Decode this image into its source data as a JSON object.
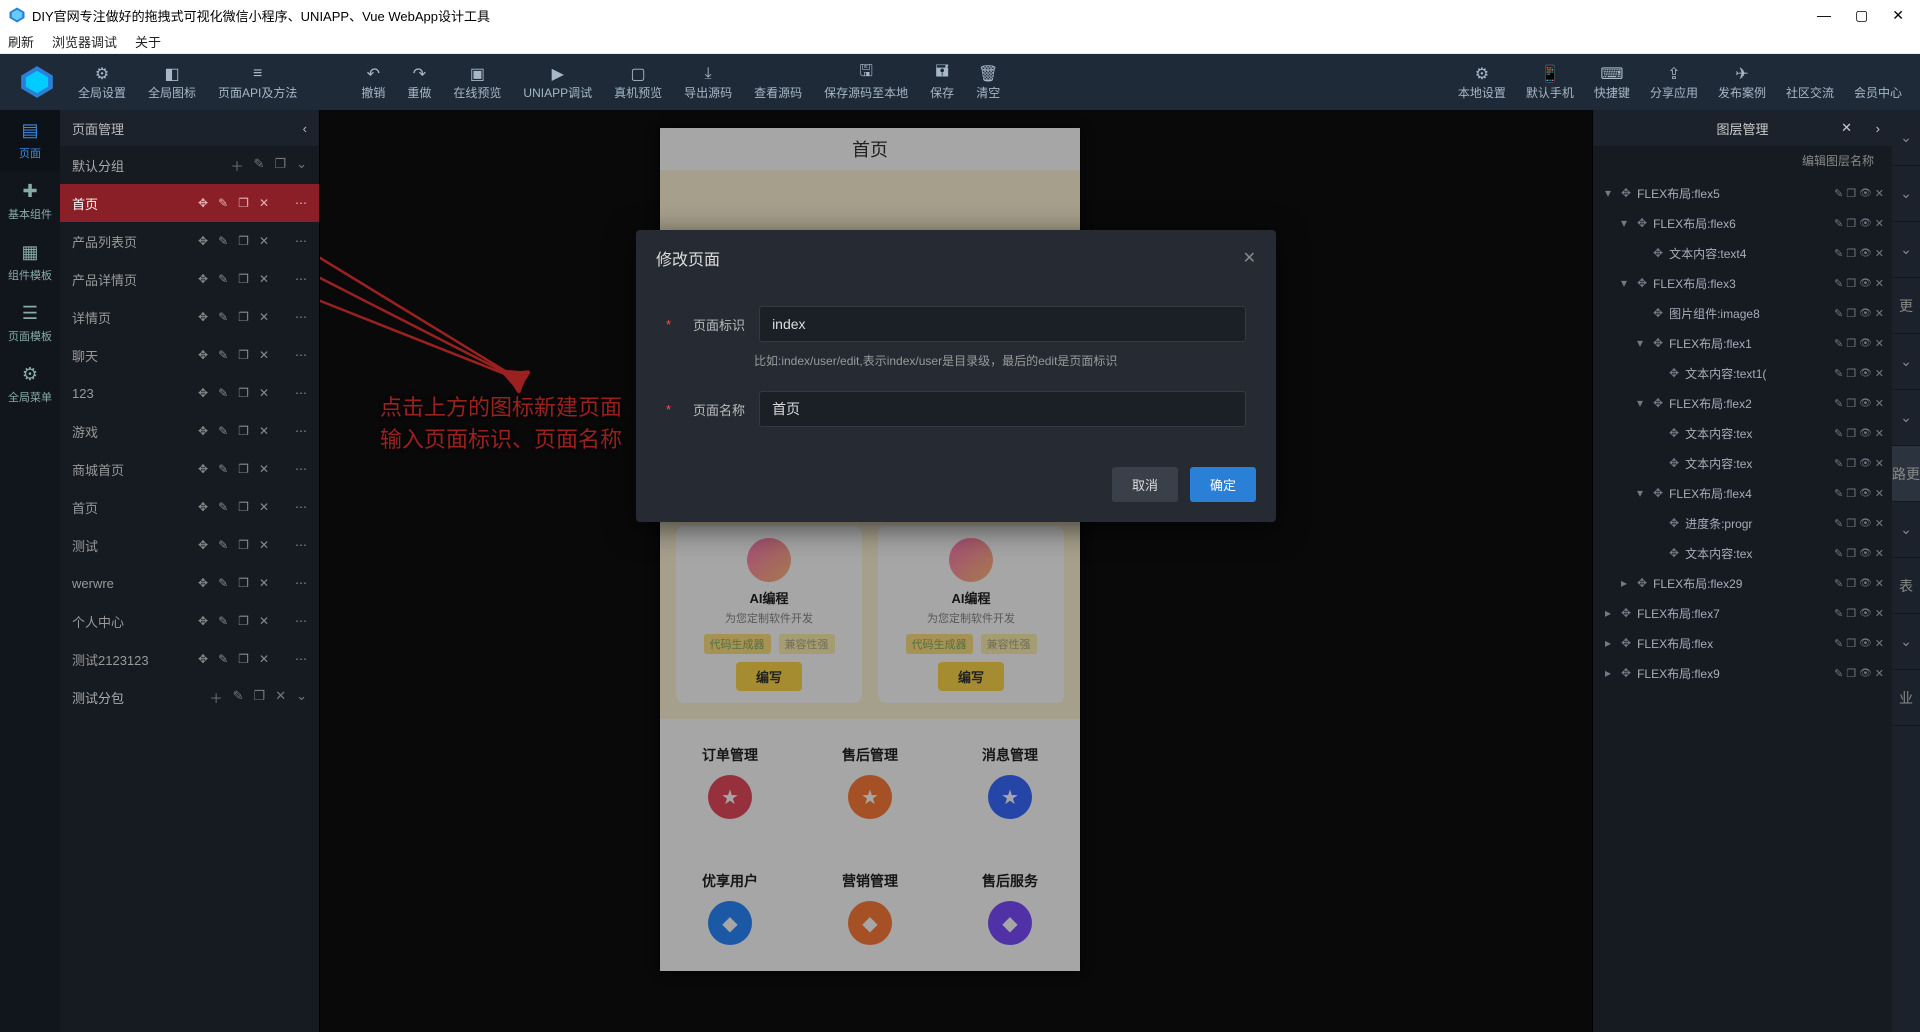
{
  "window": {
    "title": "DIY官网专注做好的拖拽式可视化微信小程序、UNIAPP、Vue WebApp设计工具"
  },
  "menubar": [
    "刷新",
    "浏览器调试",
    "关于"
  ],
  "toolbar": {
    "left": [
      {
        "label": "全局设置",
        "icon": "⚙"
      },
      {
        "label": "全局图标",
        "icon": "◧"
      },
      {
        "label": "页面API及方法",
        "icon": "≡"
      }
    ],
    "mid": [
      {
        "label": "撤销",
        "icon": "↶"
      },
      {
        "label": "重做",
        "icon": "↷"
      },
      {
        "label": "在线预览",
        "icon": "▣"
      },
      {
        "label": "UNIAPP调试",
        "icon": "▶"
      },
      {
        "label": "真机预览",
        "icon": "▢"
      },
      {
        "label": "导出源码",
        "icon": "⤓"
      },
      {
        "label": "查看源码",
        "icon": "</>"
      },
      {
        "label": "保存源码至本地",
        "icon": "🖫"
      },
      {
        "label": "保存",
        "icon": "🖬"
      },
      {
        "label": "清空",
        "icon": "🗑"
      }
    ],
    "right": [
      {
        "label": "本地设置",
        "icon": "⚙"
      },
      {
        "label": "默认手机",
        "icon": "📱"
      },
      {
        "label": "快捷键",
        "icon": "⌨"
      },
      {
        "label": "分享应用",
        "icon": "⇪"
      },
      {
        "label": "发布案例",
        "icon": "✈"
      },
      {
        "label": "社区交流",
        "icon": ""
      },
      {
        "label": "会员中心",
        "icon": ""
      }
    ]
  },
  "leftrail": [
    {
      "label": "页面",
      "icon": "▤",
      "key": "page"
    },
    {
      "label": "基本组件",
      "icon": "✚",
      "key": "basic"
    },
    {
      "label": "组件模板",
      "icon": "▦",
      "key": "tpl"
    },
    {
      "label": "页面模板",
      "icon": "☰",
      "key": "ptpl"
    },
    {
      "label": "全局菜单",
      "icon": "⚙",
      "key": "gmenu"
    }
  ],
  "pagepanel": {
    "title": "页面管理",
    "groups": [
      {
        "name": "默认分组",
        "open": true,
        "pages": [
          {
            "name": "首页",
            "selected": true
          },
          {
            "name": "产品列表页"
          },
          {
            "name": "产品详情页"
          },
          {
            "name": "详情页"
          },
          {
            "name": "聊天"
          },
          {
            "name": "123"
          },
          {
            "name": "游戏"
          },
          {
            "name": "商城首页"
          },
          {
            "name": "首页"
          },
          {
            "name": "测试"
          },
          {
            "name": "werwre"
          },
          {
            "name": "个人中心"
          },
          {
            "name": "测试2123123"
          }
        ]
      },
      {
        "name": "测试分包",
        "open": false
      }
    ]
  },
  "canvas": {
    "device_title": "首页",
    "ai_card": {
      "title": "AI编程",
      "sub": "为您定制软件开发",
      "tag1": "代码生成器",
      "tag2": "兼容性强",
      "btn": "编写"
    },
    "services_a": [
      "订单管理",
      "售后管理",
      "消息管理"
    ],
    "services_b": [
      "优享用户",
      "营销管理",
      "售后服务"
    ]
  },
  "annotation": {
    "line1": "点击上方的图标新建页面",
    "line2": "输入页面标识、页面名称"
  },
  "modal": {
    "title": "修改页面",
    "f1_label": "页面标识",
    "f1_value": "index",
    "hint": "比如:index/user/edit,表示index/user是目录级，最后的edit是页面标识",
    "f2_label": "页面名称",
    "f2_value": "首页",
    "cancel": "取消",
    "ok": "确定"
  },
  "rightpanel": {
    "title": "图层管理",
    "subtitle": "编辑图层名称",
    "layers": [
      {
        "indent": 0,
        "chev": "▾",
        "name": "FLEX布局:flex5"
      },
      {
        "indent": 1,
        "chev": "▾",
        "name": "FLEX布局:flex6"
      },
      {
        "indent": 2,
        "chev": "",
        "name": "文本内容:text4"
      },
      {
        "indent": 1,
        "chev": "▾",
        "name": "FLEX布局:flex3"
      },
      {
        "indent": 2,
        "chev": "",
        "name": "图片组件:image8"
      },
      {
        "indent": 2,
        "chev": "▾",
        "name": "FLEX布局:flex1"
      },
      {
        "indent": 3,
        "chev": "",
        "name": "文本内容:text1("
      },
      {
        "indent": 2,
        "chev": "▾",
        "name": "FLEX布局:flex2"
      },
      {
        "indent": 3,
        "chev": "",
        "name": "文本内容:tex"
      },
      {
        "indent": 3,
        "chev": "",
        "name": "文本内容:tex"
      },
      {
        "indent": 2,
        "chev": "▾",
        "name": "FLEX布局:flex4"
      },
      {
        "indent": 3,
        "chev": "",
        "name": "进度条:progr"
      },
      {
        "indent": 3,
        "chev": "",
        "name": "文本内容:tex"
      },
      {
        "indent": 1,
        "chev": "▸",
        "name": "FLEX布局:flex29"
      },
      {
        "indent": 0,
        "chev": "▸",
        "name": "FLEX布局:flex7"
      },
      {
        "indent": 0,
        "chev": "▸",
        "name": "FLEX布局:flex"
      },
      {
        "indent": 0,
        "chev": "▸",
        "name": "FLEX布局:flex9"
      }
    ]
  },
  "rightedge": [
    "",
    "",
    "",
    "更",
    "",
    "",
    "路更",
    "",
    "表",
    "",
    "业"
  ]
}
